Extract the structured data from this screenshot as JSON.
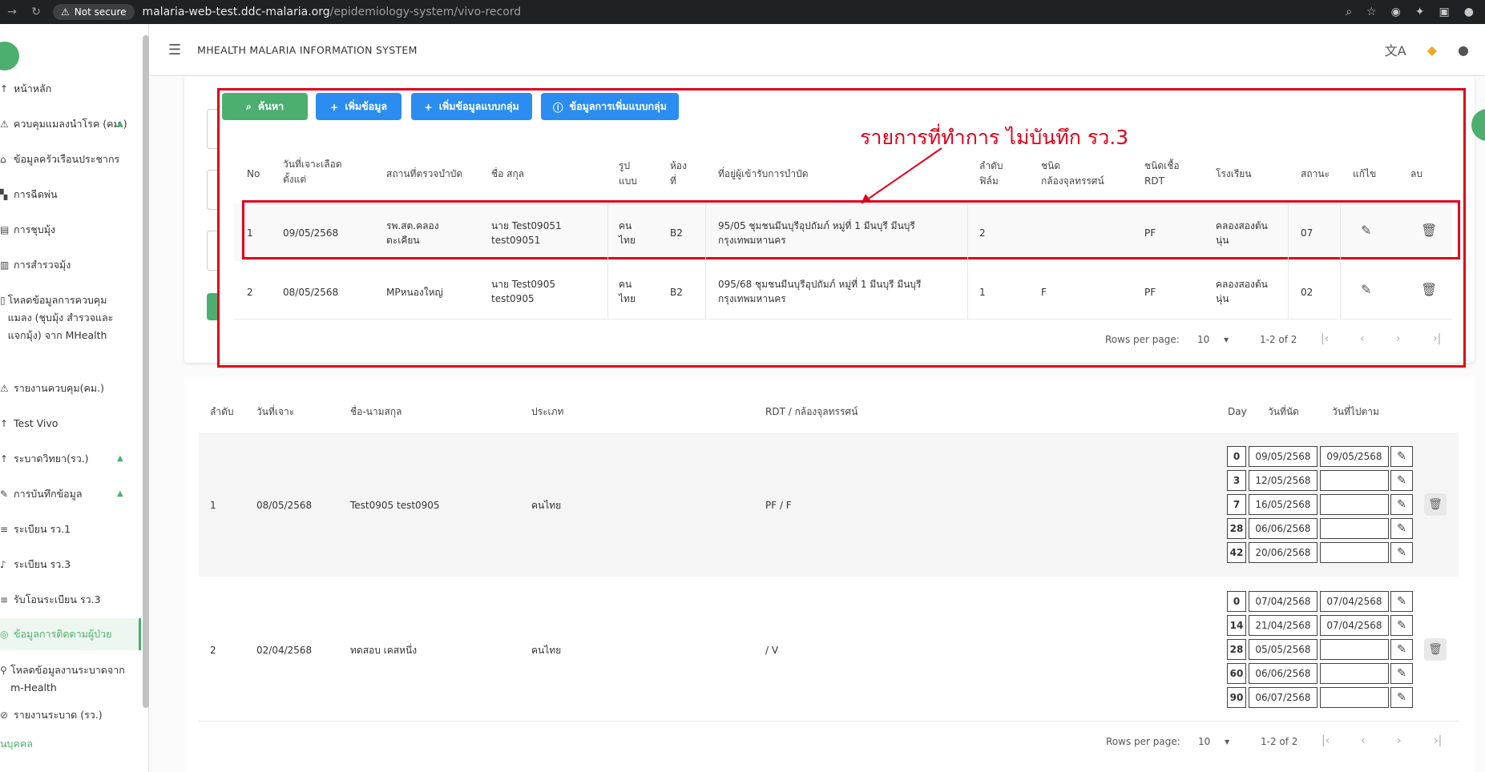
{
  "browser": {
    "secure_label": "Not secure",
    "url_host": "malaria-web-test.ddc-malaria.org",
    "url_path": "/epidemiology-system/vivo-record"
  },
  "app": {
    "title": "MHEALTH MALARIA INFORMATION SYSTEM"
  },
  "sidebar": {
    "items": [
      {
        "label": "หน้าหลัก"
      },
      {
        "label": "ควบคุมแมลงนำโรค (คม.)"
      },
      {
        "label": "ข้อมูลครัวเรือนประชากร"
      },
      {
        "label": "การฉีดพ่น"
      },
      {
        "label": "การชุบมุ้ง"
      },
      {
        "label": "การสำรวจมุ้ง"
      },
      {
        "label": "โหลดข้อมูลการควบคุมแมลง (ชุบมุ้ง สำรวจและแจกมุ้ง) จาก MHealth"
      },
      {
        "label": "รายงานควบคุม(คม.)"
      },
      {
        "label": "Test Vivo"
      },
      {
        "label": "ระบาดวิทยา(รว.)"
      },
      {
        "label": "การบันทึกข้อมูล"
      },
      {
        "label": "ระเบียน รว.1"
      },
      {
        "label": "ระเบียน รว.3"
      },
      {
        "label": "รับโอนระเบียน รว.3"
      },
      {
        "label": "ข้อมูลการติดตามผู้ป่วย"
      },
      {
        "label": "โหลดข้อมูลงานระบาดจาก m-Health"
      },
      {
        "label": "รายงานระบาด (รว.)"
      },
      {
        "label": "นบุคคล"
      }
    ]
  },
  "toolbar": {
    "search": "ค้นหา",
    "add": "เพิ่มข้อมูล",
    "add_group": "เพิ่มข้อมูลแบบกลุ่ม",
    "group_info": "ข้อมูลการเพิ่มแบบกลุ่ม"
  },
  "annotation": "รายการที่ทำการ ไม่บันทึก รว.3",
  "table1": {
    "headers": [
      "No",
      "วันที่เจาะเลือด ตั้งแต่",
      "สถานที่ตรวจบำบัด",
      "ชื่อ สกุล",
      "รูป แบบ",
      "ห้อง ที่",
      "ที่อยู่ผู้เข้ารับการบำบัด",
      "ลำดับ ฟิล์ม",
      "ชนิด กล้องจุลทรรศน์",
      "ชนิดเชื้อ RDT",
      "โรงเรียน",
      "สถานะ",
      "แก้ไข",
      "ลบ"
    ],
    "rows": [
      [
        "1",
        "09/05/2568",
        "รพ.สต.คลอง ตะเคียน",
        "นาย Test09051 test09051",
        "คน ไทย",
        "B2",
        "95/05 ชุมชนมีนบุรีอุปถัมภ์ หมู่ที่ 1 มีนบุรี มีนบุรี กรุงเทพมหานคร",
        "2",
        "",
        "PF",
        "คลองสองต้น นุ่น",
        "07"
      ],
      [
        "2",
        "08/05/2568",
        "MPหนองใหญ่",
        "นาย Test0905 test0905",
        "คน ไทย",
        "B2",
        "095/68 ชุมชนมีนบุรีอุปถัมภ์ หมู่ที่ 1 มีนบุรี มีนบุรี กรุงเทพมหานคร",
        "1",
        "F",
        "PF",
        "คลองสองต้น นุ่น",
        "02"
      ]
    ],
    "rows_per_page_label": "Rows per page:",
    "rows_per_page": "10",
    "range": "1-2 of 2"
  },
  "table2": {
    "headers": [
      "ลำดับ",
      "วันที่เจาะ",
      "ชื่อ-นามสกุล",
      "ประเภท",
      "RDT / กล้องจุลทรรศน์",
      "Day",
      "วันที่นัด",
      "วันที่ไปตาม"
    ],
    "rows": [
      {
        "no": "1",
        "date": "08/05/2568",
        "name": "Test0905 test0905",
        "type": "คนไทย",
        "rdt": "PF / F",
        "follow": [
          [
            "0",
            "09/05/2568",
            "09/05/2568"
          ],
          [
            "3",
            "12/05/2568",
            ""
          ],
          [
            "7",
            "16/05/2568",
            ""
          ],
          [
            "28",
            "06/06/2568",
            ""
          ],
          [
            "42",
            "20/06/2568",
            ""
          ]
        ]
      },
      {
        "no": "2",
        "date": "02/04/2568",
        "name": "ทดสอบ เคสหนึ่ง",
        "type": "คนไทย",
        "rdt": "/ V",
        "follow": [
          [
            "0",
            "07/04/2568",
            "07/04/2568"
          ],
          [
            "14",
            "21/04/2568",
            "07/04/2568"
          ],
          [
            "28",
            "05/05/2568",
            ""
          ],
          [
            "60",
            "06/06/2568",
            ""
          ],
          [
            "90",
            "06/07/2568",
            ""
          ]
        ]
      }
    ],
    "rows_per_page_label": "Rows per page:",
    "rows_per_page": "10",
    "range": "1-2 of 2"
  }
}
